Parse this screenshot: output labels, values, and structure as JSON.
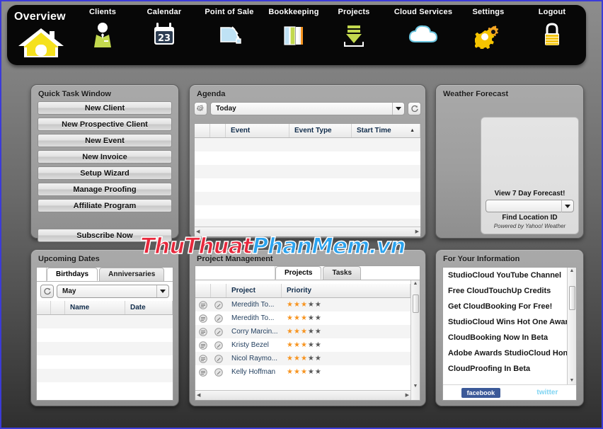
{
  "nav": {
    "items": [
      {
        "label": "Overview",
        "icon": "home-icon"
      },
      {
        "label": "Clients",
        "icon": "person-icon"
      },
      {
        "label": "Calendar",
        "icon": "calendar-icon",
        "day": "23"
      },
      {
        "label": "Point of Sale",
        "icon": "card-swipe-icon"
      },
      {
        "label": "Bookkeeping",
        "icon": "books-icon"
      },
      {
        "label": "Projects",
        "icon": "download-tray-icon"
      },
      {
        "label": "Cloud Services",
        "icon": "cloud-icon"
      },
      {
        "label": "Settings",
        "icon": "gears-icon"
      },
      {
        "label": "Logout",
        "icon": "padlock-icon"
      }
    ]
  },
  "quick_task": {
    "title": "Quick Task Window",
    "buttons": [
      "New Client",
      "New Prospective Client",
      "New Event",
      "New Invoice",
      "Setup Wizard",
      "Manage Proofing",
      "Affiliate Program"
    ],
    "subscribe": "Subscribe Now"
  },
  "agenda": {
    "title": "Agenda",
    "settings_icon": "gear-icon",
    "refresh_icon": "refresh-icon",
    "filter_value": "Today",
    "columns": [
      "",
      "",
      "Event",
      "Event Type",
      "Start Time"
    ],
    "sort_indicator": "▲",
    "rows": []
  },
  "weather": {
    "title": "Weather Forecast",
    "forecast_link": "View 7 Day Forecast!",
    "location_value": "",
    "find_location": "Find Location ID",
    "credit": "Powered by Yahoo! Weather"
  },
  "upcoming": {
    "title": "Upcoming Dates",
    "tabs": [
      {
        "label": "Birthdays",
        "active": true
      },
      {
        "label": "Anniversaries",
        "active": false
      }
    ],
    "refresh_icon": "refresh-icon",
    "month_value": "May",
    "columns": [
      "",
      "",
      "Name",
      "Date"
    ],
    "rows": []
  },
  "projects": {
    "title": "Project Management",
    "tabs": [
      {
        "label": "Projects",
        "active": true
      },
      {
        "label": "Tasks",
        "active": false
      }
    ],
    "columns": [
      "",
      "",
      "Project",
      "Priority"
    ],
    "sort_indicator": "▲",
    "star_total": 5,
    "rows": [
      {
        "name": "Meredith To...",
        "priority": 3,
        "row_icons": [
          "note-icon",
          "edit-icon"
        ]
      },
      {
        "name": "Meredith To...",
        "priority": 3,
        "row_icons": [
          "note-icon",
          "edit-icon"
        ]
      },
      {
        "name": "Corry Marcin...",
        "priority": 3,
        "row_icons": [
          "note-icon",
          "edit-icon"
        ]
      },
      {
        "name": "Kristy Bezel",
        "priority": 3,
        "row_icons": [
          "note-icon",
          "edit-icon"
        ]
      },
      {
        "name": "Nicol Raymo...",
        "priority": 3,
        "row_icons": [
          "note-icon",
          "edit-icon"
        ]
      },
      {
        "name": "Kelly Hoffman",
        "priority": 3,
        "row_icons": [
          "note-icon",
          "edit-icon"
        ]
      }
    ]
  },
  "fyi": {
    "title": "For Your Information",
    "items": [
      "StudioCloud YouTube Channel",
      "Free CloudTouchUp Credits",
      "Get CloudBooking For Free!",
      "StudioCloud Wins Hot One Award",
      "CloudBooking Now In Beta",
      "Adobe Awards StudioCloud Honor",
      "CloudProofing In Beta"
    ],
    "facebook_label": "facebook",
    "twitter_label": "twitter"
  },
  "watermark": {
    "part1": "ThuThuat",
    "part2": "PhanMem.vn"
  },
  "colors": {
    "accent_yellow": "#f5e11e",
    "star_on": "#f79420",
    "star_off": "#595959",
    "facebook_blue": "#3b5998",
    "twitter_blue": "#7fd4f2",
    "page_border": "#3b3bd8"
  }
}
